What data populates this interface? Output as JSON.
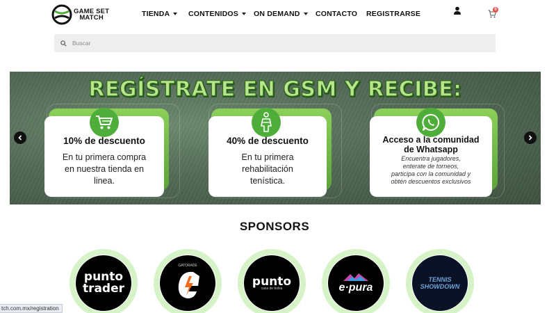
{
  "header": {
    "logo_text_line1": "GAME SET",
    "logo_text_line2": "MATCH",
    "nav": [
      {
        "label": "TIENDA",
        "has_dropdown": true
      },
      {
        "label": "CONTENIDOS",
        "has_dropdown": true
      },
      {
        "label": "ON DEMAND",
        "has_dropdown": true
      },
      {
        "label": "CONTACTO",
        "has_dropdown": false
      },
      {
        "label": "REGISTRARSE",
        "has_dropdown": false
      }
    ],
    "user_icon": "user-icon",
    "cart_icon": "cart-icon",
    "cart_count": "0"
  },
  "search": {
    "placeholder": "Buscar",
    "value": ""
  },
  "banner": {
    "title": "REGÍSTRATE EN GSM Y RECIBE:",
    "cards": [
      {
        "icon": "cart-icon",
        "title": "10% de descuento",
        "body": [
          "En tu primera compra",
          "en nuestra tienda en",
          "linea."
        ]
      },
      {
        "icon": "rehab-icon",
        "title": "40% de descuento",
        "body": [
          "En tu primera",
          "rehabilitación",
          "tenística."
        ]
      },
      {
        "icon": "whatsapp-icon",
        "title_lines": [
          "Acceso a la comunidad",
          "de Whatsapp"
        ],
        "body": [
          "Encuentra jugadores,",
          "enterate de torneos,",
          "participa con la comunidad y",
          "obtén descuentos exclusivos"
        ]
      }
    ],
    "prev_icon": "chevron-left-icon",
    "next_icon": "chevron-right-icon"
  },
  "sponsors": {
    "title": "SPONSORS",
    "items": [
      {
        "name": "punto trader",
        "line1": "punto",
        "line2": "trader"
      },
      {
        "name": "Gatorade",
        "line1": "G",
        "small": "GATORADE"
      },
      {
        "name": "punto casa de bolsa",
        "line1": "punto",
        "small": "casa de bolsa"
      },
      {
        "name": "e-pura",
        "line1": "e·pura"
      },
      {
        "name": "Tennis Showdown",
        "line1": "TENNIS",
        "line2": "SHOWDOWN"
      }
    ]
  },
  "status_bar": {
    "url": "tch.com.mx/registration"
  },
  "colors": {
    "accent_green": "#4fae3a",
    "banner_bg": "#546b57",
    "title_green": "#b9e58a",
    "badge_red": "#e2534a"
  }
}
